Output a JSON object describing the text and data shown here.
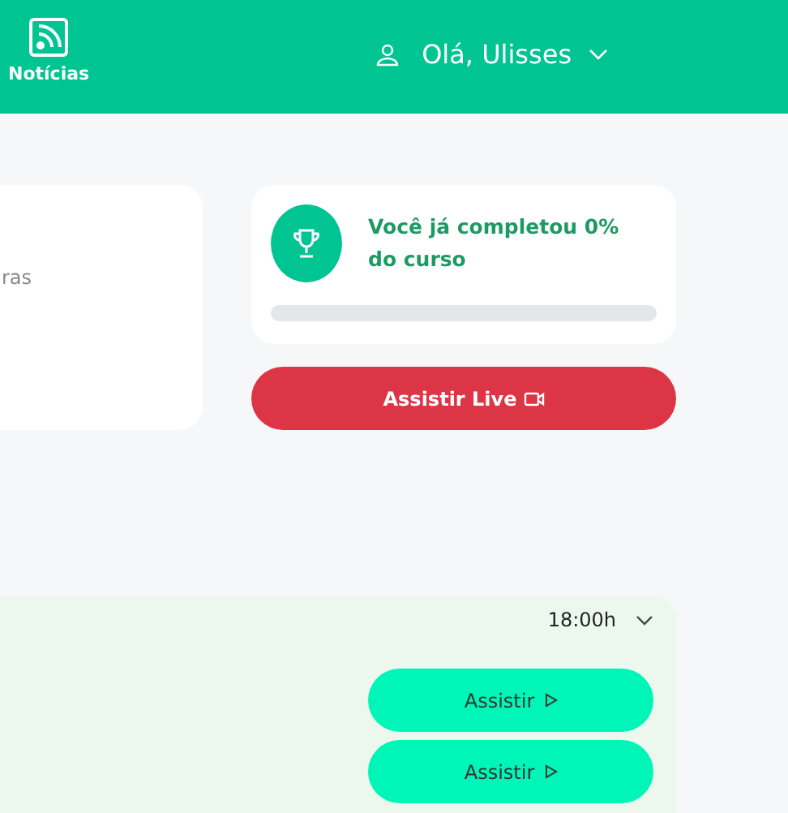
{
  "header": {
    "news_link": {
      "label": "Notícias"
    },
    "user_menu": {
      "greeting": "Olá, Ulisses"
    }
  },
  "left_card": {
    "text_fragment": "ras"
  },
  "progress_card": {
    "message": "Você já completou 0% do curso",
    "level": 0
  },
  "live_button": {
    "label": "Assistir Live"
  },
  "schedule": {
    "time": "18:00h",
    "expanded": true,
    "buttons": [
      {
        "label": "Assistir"
      },
      {
        "label": "Assistir"
      }
    ]
  }
}
